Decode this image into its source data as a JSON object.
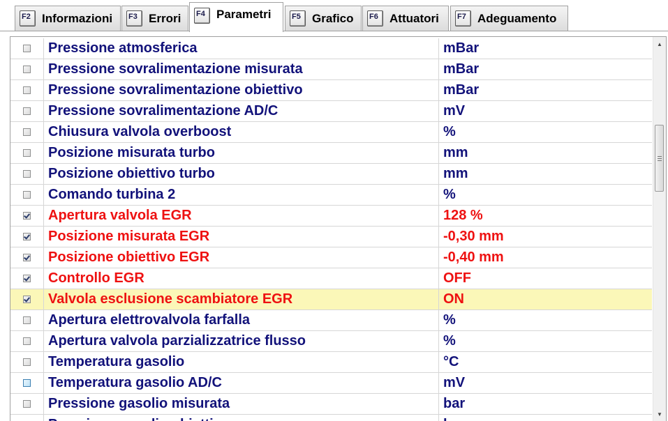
{
  "tabs": [
    {
      "key": "F2",
      "label": "Informazioni",
      "active": false
    },
    {
      "key": "F3",
      "label": "Errori",
      "active": false
    },
    {
      "key": "F4",
      "label": "Parametri",
      "active": true
    },
    {
      "key": "F5",
      "label": "Grafico",
      "active": false
    },
    {
      "key": "F6",
      "label": "Attuatori",
      "active": false
    },
    {
      "key": "F7",
      "label": "Adeguamento",
      "active": false
    }
  ],
  "colors": {
    "parameter_text": "#12127a",
    "selected_parameter_text": "#ee1111",
    "highlight_row": "#fbf7b8"
  },
  "parameters": [
    {
      "name": "Pressione atmosferica",
      "value": "mBar",
      "checked": false
    },
    {
      "name": "Pressione sovralimentazione misurata",
      "value": "mBar",
      "checked": false
    },
    {
      "name": "Pressione sovralimentazione obiettivo",
      "value": "mBar",
      "checked": false
    },
    {
      "name": "Pressione sovralimentazione AD/C",
      "value": "mV",
      "checked": false
    },
    {
      "name": "Chiusura valvola overboost",
      "value": "%",
      "checked": false
    },
    {
      "name": "Posizione misurata turbo",
      "value": "mm",
      "checked": false
    },
    {
      "name": "Posizione obiettivo turbo",
      "value": "mm",
      "checked": false
    },
    {
      "name": "Comando turbina 2",
      "value": "%",
      "checked": false
    },
    {
      "name": "Apertura valvola EGR",
      "value": "128 %",
      "checked": true
    },
    {
      "name": "Posizione misurata EGR",
      "value": "-0,30 mm",
      "checked": true
    },
    {
      "name": "Posizione obiettivo EGR",
      "value": "-0,40 mm",
      "checked": true
    },
    {
      "name": "Controllo EGR",
      "value": "OFF",
      "checked": true
    },
    {
      "name": "Valvola esclusione scambiatore EGR",
      "value": "ON",
      "checked": true,
      "highlighted": true
    },
    {
      "name": "Apertura elettrovalvola farfalla",
      "value": "%",
      "checked": false
    },
    {
      "name": "Apertura valvola parzializzatrice flusso",
      "value": "%",
      "checked": false
    },
    {
      "name": "Temperatura gasolio",
      "value": "°C",
      "checked": false
    },
    {
      "name": "Temperatura gasolio AD/C",
      "value": "mV",
      "checked": false,
      "focused": true
    },
    {
      "name": "Pressione gasolio misurata",
      "value": "bar",
      "checked": false
    },
    {
      "name": "Pressione gasolio obiettivo",
      "value": "bar",
      "checked": false
    }
  ],
  "scrollbar": {
    "up_icon": "arrow-up-icon",
    "down_icon": "arrow-down-icon"
  }
}
